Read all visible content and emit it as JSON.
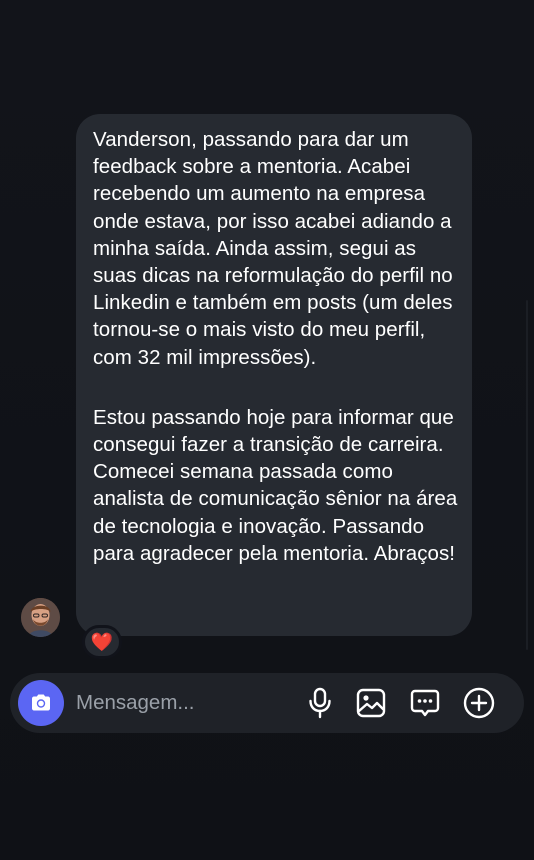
{
  "conversation": {
    "message": {
      "paragraph_1": "Vanderson, passando para dar um feedback sobre a mentoria. Acabei recebendo um aumento na empresa onde estava, por isso acabei adiando a minha saída. Ainda assim, segui as suas dicas na reformulação do perfil no Linkedin e também em posts (um deles tornou-se o mais visto do meu perfil, com 32 mil impressões).",
      "paragraph_2": "Estou passando hoje para informar que consegui fazer a transição de carreira. Comecei semana passada como analista de comunicação sênior na área de tecnologia e inovação. Passando para agradecer pela mentoria. Abraços!",
      "reaction": "❤️"
    }
  },
  "composer": {
    "placeholder": "Mensagem...",
    "icons": {
      "camera": "camera-icon",
      "microphone": "microphone-icon",
      "gallery": "image-icon",
      "sticker": "chat-sticker-icon",
      "more": "plus-circle-icon"
    }
  },
  "colors": {
    "background": "#11131a",
    "bubble": "#262a31",
    "text": "#ffffff",
    "camera_button": "#5b66f3",
    "composer": "#1f2228",
    "placeholder": "#9aa0a8"
  }
}
